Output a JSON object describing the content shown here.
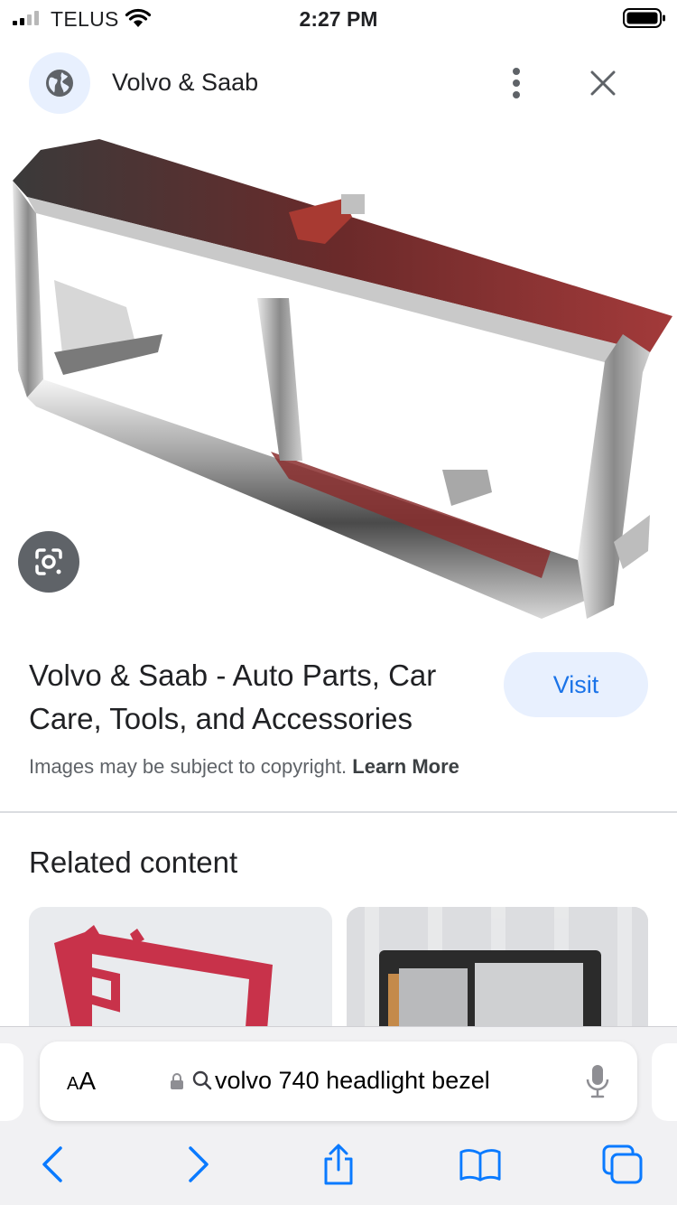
{
  "status_bar": {
    "carrier": "TELUS",
    "time": "2:27 PM"
  },
  "header": {
    "site_name": "Volvo & Saab",
    "icons": [
      "globe-icon",
      "more-vert-icon",
      "close-icon"
    ]
  },
  "result": {
    "title": "Volvo & Saab - Auto Parts, Car Care, Tools, and Accessories",
    "visit_label": "Visit",
    "copyright_text": "Images may be subject to copyright.",
    "learn_more_label": "Learn More"
  },
  "related": {
    "title": "Related content"
  },
  "browser": {
    "text_size_label_small": "A",
    "text_size_label_large": "A",
    "search_query": "volvo 740 headlight bezel",
    "icons": [
      "lock-icon",
      "search-icon",
      "microphone-icon",
      "back-icon",
      "forward-icon",
      "share-icon",
      "bookmarks-icon",
      "tabs-icon"
    ]
  },
  "colors": {
    "accent": "#1a73e8",
    "visit_bg": "#e8f0fe",
    "ios_blue": "#0a7aff",
    "chrome_red": "#a33a3a"
  }
}
